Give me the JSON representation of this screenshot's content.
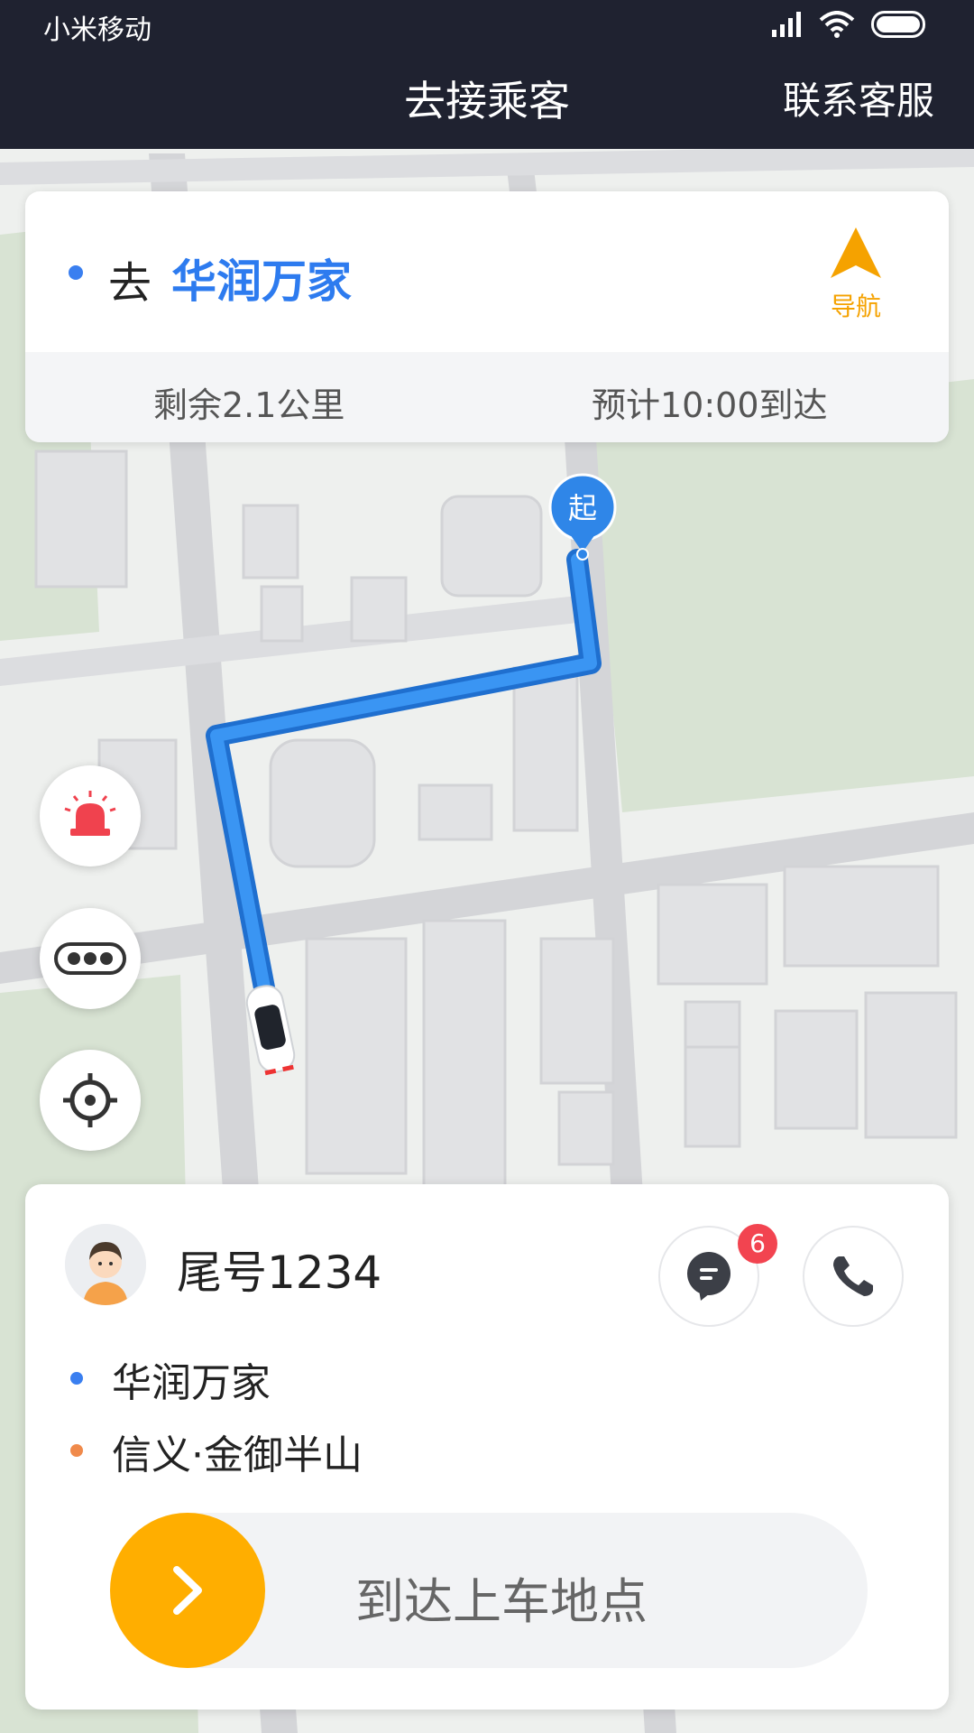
{
  "status_bar": {
    "carrier": "小米移动",
    "icons": [
      "signal-icon",
      "wifi-icon",
      "battery-icon"
    ]
  },
  "header": {
    "title": "去接乘客",
    "contact_label": "联系客服"
  },
  "destination": {
    "prefix": "去",
    "name": "华润万家",
    "nav_label": "导航",
    "remaining": "剩余2.1公里",
    "eta": "预计10:00到达"
  },
  "map": {
    "start_marker_label": "起",
    "route_color": "#2f86e8",
    "icons": [
      "car-icon",
      "start-pin-icon"
    ]
  },
  "map_buttons": [
    "alarm-icon",
    "more-icon",
    "locate-icon"
  ],
  "passenger": {
    "tail_number": "尾号1234",
    "chat_badge": "6",
    "pickup": "华润万家",
    "dropoff": "信义·金御半山",
    "slider_label": "到达上车地点"
  },
  "colors": {
    "accent_blue": "#2d7bef",
    "accent_orange": "#ffae00",
    "nav_yellow": "#f5a200",
    "badge_red": "#f24450",
    "header_bg": "#1f2230"
  }
}
